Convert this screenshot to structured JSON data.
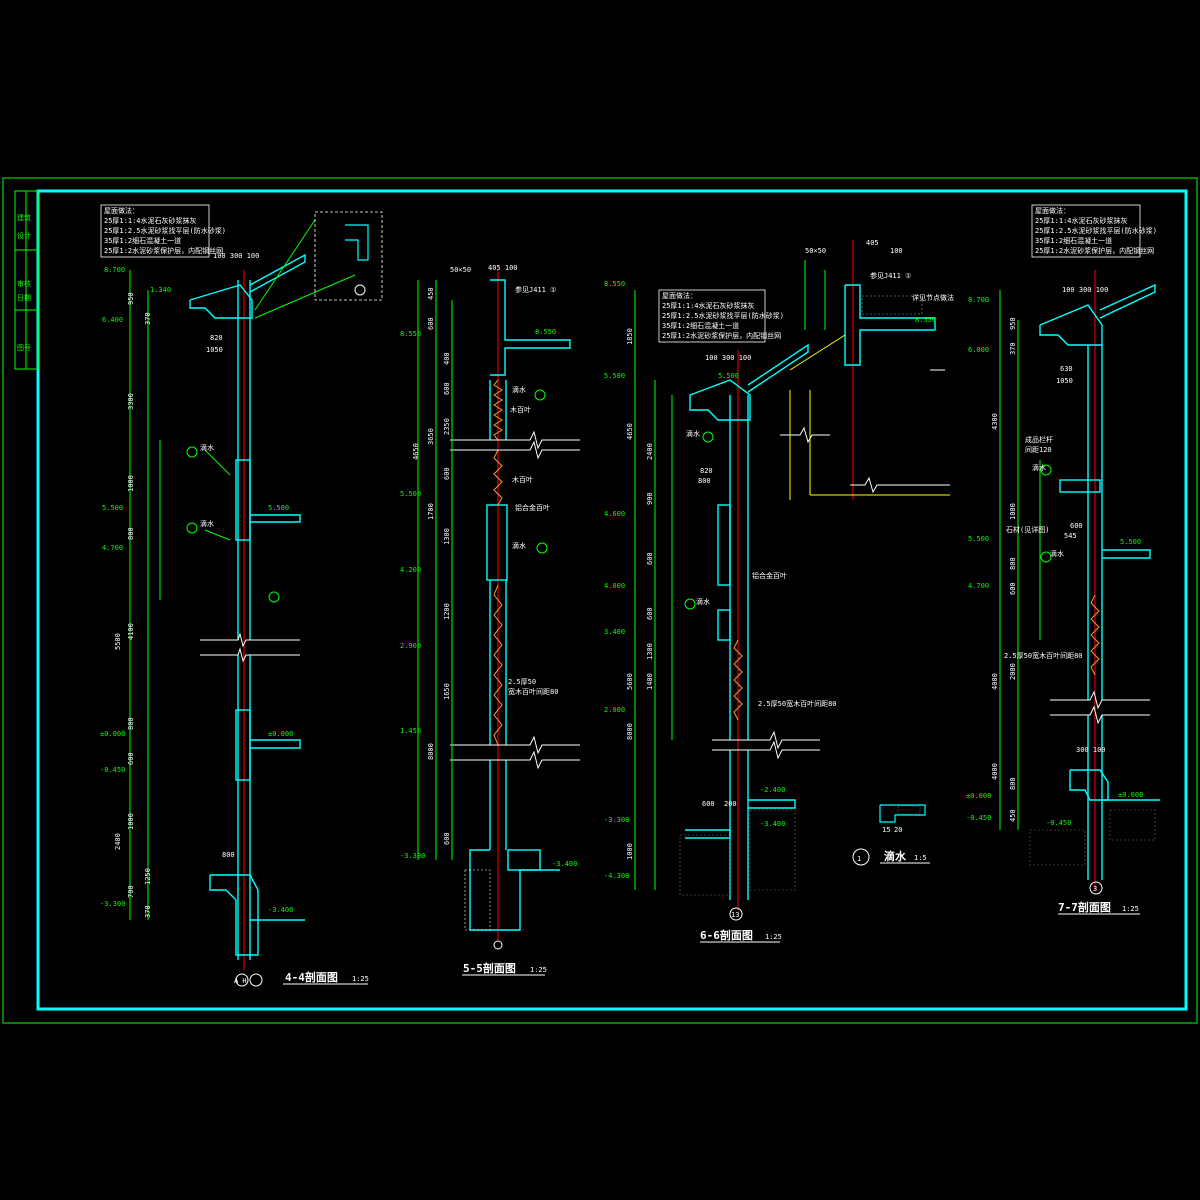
{
  "drawing": {
    "colors": {
      "background": "#000000",
      "outer_frame": "#00ff00",
      "inner_frame": "#00ffff",
      "wall": "#00ffff",
      "dimension": "#00ff00",
      "axis": "#ff0000",
      "text": "#ffffff",
      "leader": "#ffff00"
    },
    "sections": [
      {
        "title": "4-4剖面图",
        "scale": "1:25",
        "axis": "A H"
      },
      {
        "title": "5-5剖面图",
        "scale": "1:25",
        "axis": ""
      },
      {
        "title": "6-6剖面图",
        "scale": "1:25",
        "axis": "13"
      },
      {
        "title": "7-7剖面图",
        "scale": "1:25",
        "axis": "3"
      }
    ],
    "detail": {
      "number": "1",
      "title": "滴水",
      "scale": "1:5"
    },
    "elevations": {
      "s44": [
        "8.700",
        "1.340",
        "6.400",
        "5.500",
        "4.700",
        "±0.000",
        "-0.450",
        "-3.300"
      ],
      "s55": [
        "8.550",
        "5.500",
        "4.200",
        "2.900",
        "1.450",
        "-3.300"
      ],
      "s66": [
        "8.550",
        "5.500",
        "4.600",
        "4.000",
        "3.400",
        "2.000",
        "-3.300",
        "-4.300"
      ],
      "s77": [
        "8.700",
        "6.000",
        "5.500",
        "4.700",
        "±0.000",
        "-0.450"
      ]
    },
    "tags": {
      "s44": [
        "5.500",
        "±0.000",
        "-3.400"
      ],
      "s55": [
        "8.550",
        "-3.400"
      ],
      "s66": [
        "5.500",
        "-2.400",
        "-3.400"
      ],
      "s77": [
        "5.500",
        "±0.000",
        "-0.450"
      ],
      "detail_top": [
        "8.550"
      ]
    },
    "dims": {
      "s44_top": "100 300 100",
      "s44_eave": [
        "820",
        "1050"
      ],
      "s44_bottom": "800",
      "s66_top": "100 300 100",
      "s66_eave": [
        "820",
        "800"
      ],
      "s66_bottom": [
        "600",
        "200"
      ],
      "s77_top": "100 300 100",
      "s77_eave": [
        "630",
        "1050"
      ],
      "s77_mid": [
        "600",
        "545"
      ],
      "s77_bottom": "300 100",
      "s55_top": [
        "50×50",
        "405 100"
      ],
      "detail_top": [
        "50×50",
        "405",
        "100"
      ],
      "detail_drip": [
        "15",
        "20"
      ]
    },
    "vertical_dims": {
      "s44": [
        "950",
        "370",
        "3300",
        "1000",
        "800",
        "4100",
        "5500",
        "800",
        "600",
        "1000",
        "2400",
        "1250",
        "700",
        "370"
      ],
      "s55": [
        "450",
        "600",
        "400",
        "600",
        "2350",
        "3650",
        "4650",
        "600",
        "1700",
        "1300",
        "1200",
        "1650",
        "8000",
        "600"
      ],
      "s66": [
        "1850",
        "4650",
        "2400",
        "900",
        "600",
        "600",
        "1300",
        "1400",
        "5600",
        "8000",
        "1000"
      ],
      "s77": [
        "950",
        "370",
        "4300",
        "1000",
        "800",
        "600",
        "2000",
        "4000",
        "800",
        "4000",
        "450"
      ]
    },
    "spec_blocks": {
      "s44": [
        "屋面做法：",
        "25厚1:1:4水泥石灰砂浆抹灰",
        "25厚1:2.5水泥砂浆找平层(防水砂浆)",
        "35厚1:2细石混凝土一道",
        "25厚1:2水泥砂浆保护层，内配钢丝网"
      ],
      "s66": [
        "屋面做法：",
        "25厚1:1:4水泥石灰砂浆抹灰",
        "25厚1:2.5水泥砂浆找平层(防水砂浆)",
        "35厚1:2细石混凝土一道",
        "25厚1:2水泥砂浆保护层，内配钢丝网"
      ],
      "s77": [
        "屋面做法：",
        "25厚1:1:4水泥石灰砂浆抹灰",
        "25厚1:2.5水泥砂浆找平层(防水砂浆)",
        "35厚1:2细石混凝土一道",
        "25厚1:2水泥砂浆保护层，内配钢丝网"
      ]
    },
    "notes": {
      "drip": "滴水",
      "wood_louver": "木百叶",
      "alu_louver": "铝合金百叶",
      "louver_66": "铝合金百叶",
      "batten": "2.5厚50宽木百叶间距80",
      "batten_2": "2.5厚50",
      "batten_3": "宽木百叶间距80",
      "batten_66": "2.5厚50宽木百叶间距80",
      "batten_77": "2.5厚50宽木百叶间距80",
      "rail": "成品栏杆",
      "rail_2": "间距120",
      "sill": "石材(见详图)",
      "ref_66": "参见J411 ①",
      "ref_55": "参见J411 ①",
      "ref_detail": "参见J411 ①",
      "ref_detail_2": "详见节点做法"
    },
    "side_titles": [
      "建筑",
      "设计",
      "审核",
      "日期",
      "图号"
    ]
  }
}
